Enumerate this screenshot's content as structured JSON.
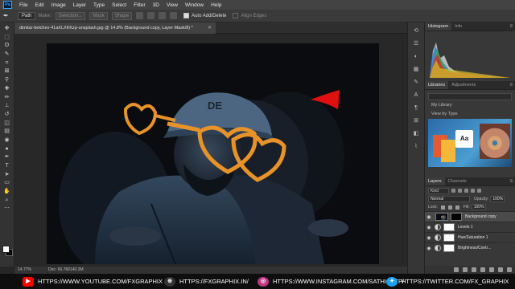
{
  "menubar": {
    "logo": "Ps",
    "items": [
      "File",
      "Edit",
      "Image",
      "Layer",
      "Type",
      "Select",
      "Filter",
      "3D",
      "View",
      "Window",
      "Help"
    ]
  },
  "options": {
    "mode": "Path",
    "make_label": "Make:",
    "selection_btn": "Selection...",
    "mask_btn": "Mask",
    "shape_btn": "Shape",
    "auto_add_delete": "Auto Add/Delete",
    "align_edges": "Align Edges"
  },
  "document": {
    "tab_title": "dimitar-belchev-41aXLXKKzp-unsplash.jpg @ 14.8% (Background copy, Layer Mask/8) *",
    "zoom": "14.77%",
    "doc_size": "Doc: 66.7M/140.3M"
  },
  "panels": {
    "histogram_tabs": [
      "Histogram",
      "Info"
    ],
    "library_tabs": [
      "Libraries",
      "Adjustments"
    ],
    "library_name": "My Library",
    "view_by": "View by Type",
    "library_item": "Aa",
    "layers_tabs": [
      "Layers",
      "Channels"
    ],
    "kind": "Kind",
    "blend_mode": "Normal",
    "opacity_label": "Opacity:",
    "opacity": "100%",
    "lock_label": "Lock:",
    "fill_label": "Fill:",
    "fill": "100%",
    "layers": [
      {
        "name": "Background copy"
      },
      {
        "name": "Levels 1"
      },
      {
        "name": "Hue/Saturation 1"
      },
      {
        "name": "Brightness/Contr..."
      }
    ]
  },
  "social": {
    "youtube": "HTTPS://WWW.YOUTUBE.COM/FXGRAPHIX",
    "website": "HTTPS://FXGRAPHIX.IN/",
    "instagram": "HTTPS://WWW.INSTAGRAM.COM/SATHISHTP/",
    "twitter": "HTTPS://TWITTER.COM/FX_GRAPHIX"
  },
  "colors": {
    "youtube": "#ff0000",
    "instagram": "#c13584",
    "twitter": "#1da1f2",
    "sunglasses": "#e8922a",
    "red_shape": "#e01010"
  }
}
